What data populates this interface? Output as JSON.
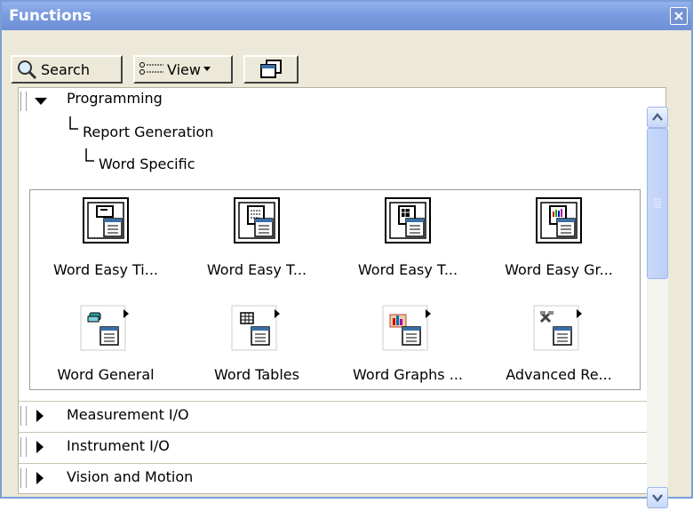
{
  "window": {
    "title": "Functions"
  },
  "toolbar": {
    "search_label": "Search",
    "view_label": "View"
  },
  "tree": {
    "programming": "Programming",
    "report_generation": "Report Generation",
    "word_specific": "Word Specific"
  },
  "palette": {
    "items": [
      {
        "label": "Word Easy Ti...",
        "icon": "word-easy-title-icon"
      },
      {
        "label": "Word Easy T...",
        "icon": "word-easy-text-icon"
      },
      {
        "label": "Word Easy T...",
        "icon": "word-easy-table-icon"
      },
      {
        "label": "Word Easy Gr...",
        "icon": "word-easy-graph-icon"
      },
      {
        "label": "Word General",
        "icon": "word-general-icon"
      },
      {
        "label": "Word Tables",
        "icon": "word-tables-icon"
      },
      {
        "label": "Word Graphs ...",
        "icon": "word-graphs-icon"
      },
      {
        "label": "Advanced Re...",
        "icon": "advanced-report-icon"
      }
    ]
  },
  "categories": [
    "Measurement I/O",
    "Instrument I/O",
    "Vision and Motion"
  ]
}
